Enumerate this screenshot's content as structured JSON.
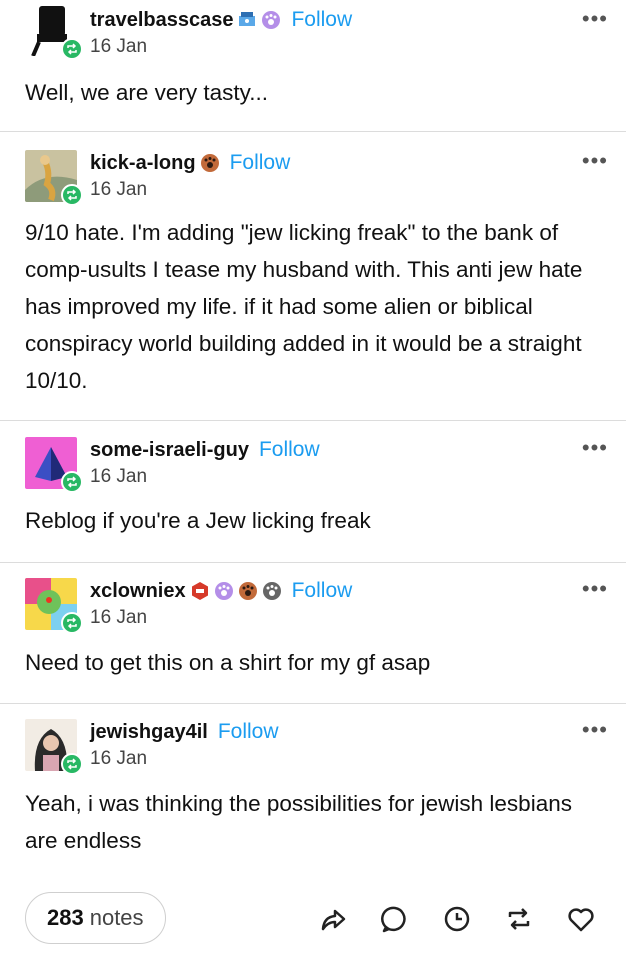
{
  "posts": [
    {
      "username": "travelbasscase",
      "follow": "Follow",
      "date": "16 Jan",
      "text": "Well, we are very tasty...",
      "more": "•••"
    },
    {
      "username": "kick-a-long",
      "follow": "Follow",
      "date": "16 Jan",
      "text": "9/10 hate. I'm adding \"jew licking freak\" to the bank of comp-usults I tease my husband with. This anti jew hate has improved my life. if it had some alien or biblical conspiracy world building added in it would be a straight 10/10.",
      "more": "•••"
    },
    {
      "username": "some-israeli-guy",
      "follow": "Follow",
      "date": "16 Jan",
      "text": "Reblog if you're a Jew licking freak",
      "more": "•••"
    },
    {
      "username": "xclowniex",
      "follow": "Follow",
      "date": "16 Jan",
      "text": "Need to get this on a shirt for my gf asap",
      "more": "•••"
    },
    {
      "username": "jewishgay4il",
      "follow": "Follow",
      "date": "16 Jan",
      "text": "Yeah, i was thinking the possibilities for jewish lesbians are endless",
      "more": "•••"
    }
  ],
  "footer": {
    "notes_count": "283",
    "notes_label": "notes"
  },
  "icons": {
    "share": "share-icon",
    "reply": "reply-icon",
    "history": "clock-icon",
    "reblog": "reblog-icon",
    "like": "heart-icon"
  },
  "colors": {
    "follow": "#1b9cf0",
    "reblog_badge": "#28b864"
  }
}
